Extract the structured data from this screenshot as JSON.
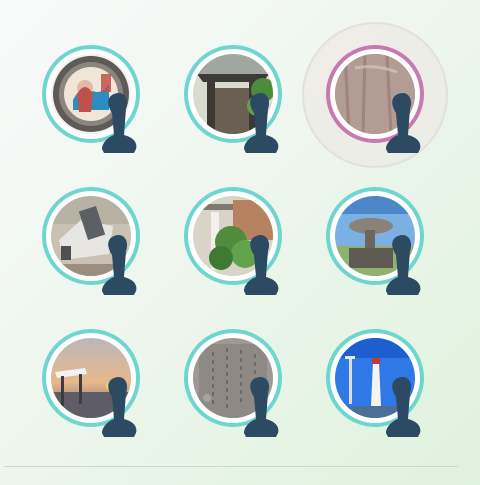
{
  "badges": [
    {
      "id": "b1",
      "subject": "manhole-cover",
      "selected": false
    },
    {
      "id": "b2",
      "subject": "shrine-gate",
      "selected": false
    },
    {
      "id": "b3",
      "subject": "stone-monument",
      "selected": true
    },
    {
      "id": "b4",
      "subject": "sculpture-block",
      "selected": false
    },
    {
      "id": "b5",
      "subject": "garden-sign",
      "selected": false
    },
    {
      "id": "b6",
      "subject": "pedestal-monument",
      "selected": false
    },
    {
      "id": "b7",
      "subject": "sunset-shelter",
      "selected": false
    },
    {
      "id": "b8",
      "subject": "inscribed-stone",
      "selected": false
    },
    {
      "id": "b9",
      "subject": "lighthouse",
      "selected": false
    }
  ],
  "colors": {
    "ring": "#6fd6cf",
    "ring_selected": "#c77ab0",
    "pin": "#2d4a63",
    "halo": "#ece6e2"
  },
  "icons": {
    "pin": "location-pin-icon"
  }
}
